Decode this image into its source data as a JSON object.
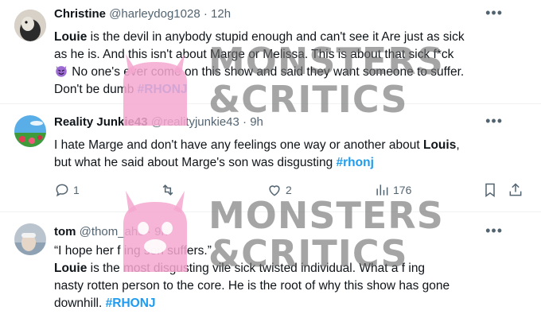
{
  "tweets": [
    {
      "name": "Christine",
      "handle": "@harleydog1028",
      "dot": "·",
      "time": "12h",
      "lines": [
        {
          "bold": "Louie",
          "text": " is the devil in anybody stupid enough and can't see it Are just as sick"
        },
        {
          "text": "as he is.  And this isn't about Marge or Melissa. This is about that sick f*ck"
        },
        {
          "text": " No one's ever come on this show and said they want someone to suffer."
        },
        {
          "text": "Don't be dumb ",
          "tag": "#RHONJ"
        }
      ]
    },
    {
      "name": "Reality Junkie43",
      "handle": "@realityjunkie43",
      "dot": "·",
      "time": "9h",
      "lines": [
        {
          "text": "I hate Marge and don't have any feelings one way or another about ",
          "bold": "Louis",
          "after": ","
        },
        {
          "text": "but what he said about Marge's son was disgusting ",
          "tag": "#rhonj"
        }
      ],
      "actions": {
        "replies": "1",
        "retweets": "",
        "likes": "2",
        "views": "176"
      }
    },
    {
      "name": "tom",
      "handle": "@thom_ahs",
      "dot": "·",
      "time": "9h",
      "lines": [
        {
          "text": "“I hope her f    ing son suffers.”"
        },
        {
          "bold": "Louie",
          "text": " is the most disgusting vile sick twisted individual. What a f   ing"
        },
        {
          "text": "nasty rotten person to the core. He is the root of why this show has gone"
        },
        {
          "text": "downhill. ",
          "tag": "#RHONJ"
        }
      ]
    }
  ],
  "watermark": {
    "line1": "MONSTERS",
    "line2": "&CRITICS"
  },
  "colors": {
    "text": "#0f1419",
    "muted": "#536471",
    "link": "#1d9bf0",
    "mascot": "#f4a7cf",
    "watermark": "#6e6e6e"
  },
  "icons": [
    "reply-icon",
    "retweet-icon",
    "like-icon",
    "views-icon",
    "bookmark-icon",
    "share-icon",
    "more-icon",
    "devil-emoji-icon"
  ]
}
